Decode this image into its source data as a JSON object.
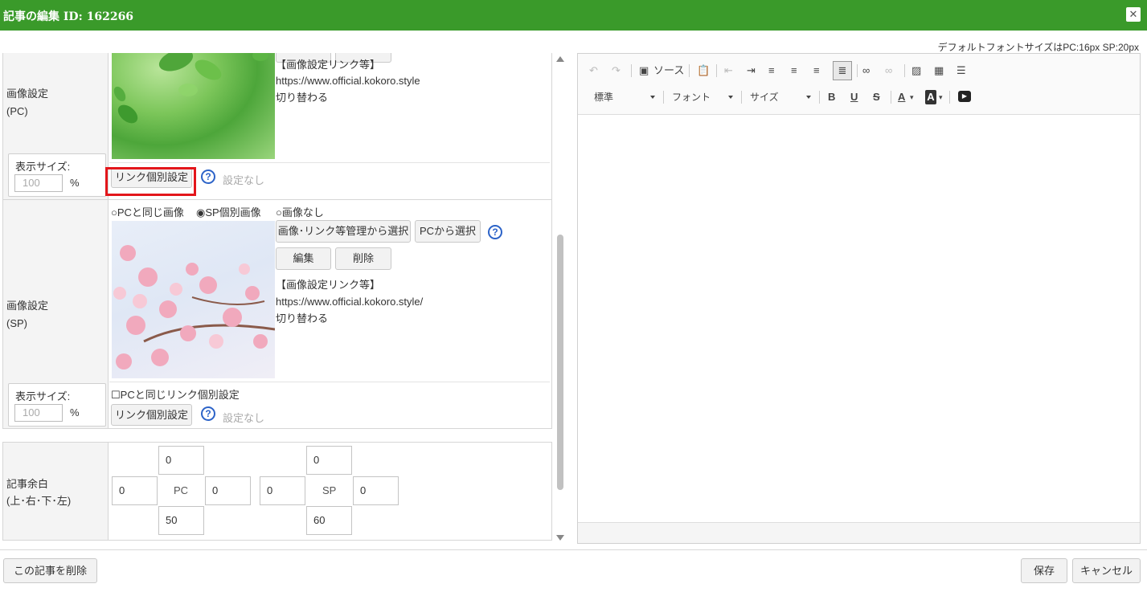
{
  "window": {
    "title": "記事の編集 ID: 162266",
    "close_icon": "close-icon"
  },
  "font_info": "デフォルトフォントサイズはPC:16px SP:20px",
  "pc_image": {
    "label_line1": "画像設定",
    "label_line2": "(PC)",
    "size_label": "表示サイズ:",
    "size_value": "100",
    "size_unit": "%",
    "link_info_title": "【画像設定リンク等】",
    "link_url": "https://www.official.kokoro.style",
    "link_action": "切り替わる",
    "link_button": "リンク個別設定",
    "link_status": "設定なし"
  },
  "sp_image": {
    "label_line1": "画像設定",
    "label_line2": "(SP)",
    "option_same": "○PCと同じ画像",
    "option_individual": "◉SP個別画像",
    "option_none": "○画像なし",
    "select_button": "画像･リンク等管理から選択",
    "pc_select_button": "PCから選択",
    "edit_button": "編集",
    "delete_button": "削除",
    "link_info_title": "【画像設定リンク等】",
    "link_url": "https://www.official.kokoro.style/",
    "link_action": "切り替わる",
    "size_label": "表示サイズ:",
    "size_value": "100",
    "size_unit": "%",
    "same_link_checkbox": "☐PCと同じリンク個別設定",
    "link_button": "リンク個別設定",
    "link_status": "設定なし"
  },
  "margin": {
    "label_line1": "記事余白",
    "label_line2": "(上･右･下･左)",
    "pc_label": "PC",
    "sp_label": "SP",
    "pc": {
      "top": "0",
      "right": "0",
      "bottom": "50",
      "left": "0"
    },
    "sp": {
      "top": "0",
      "right": "0",
      "bottom": "60",
      "left": "0"
    }
  },
  "editor": {
    "source_label": "ソース",
    "format_combo": "標準",
    "font_combo": "フォント",
    "size_combo": "サイズ",
    "bold": "B",
    "underline": "U",
    "strike": "S",
    "text_color": "A",
    "bg_color": "A"
  },
  "footer": {
    "delete_article": "この記事を削除",
    "save": "保存",
    "cancel": "キャンセル"
  },
  "colors": {
    "titlebar": "#3a9a2a",
    "highlight": "#e3161b",
    "help": "#2c63c8"
  }
}
